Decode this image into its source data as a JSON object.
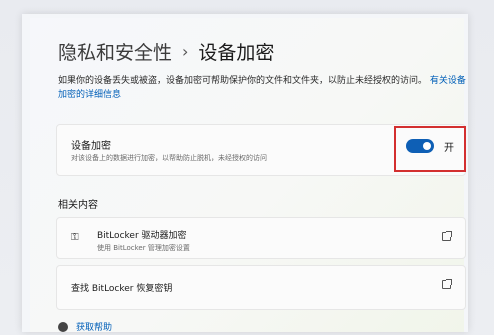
{
  "breadcrumb": {
    "parent": "隐私和安全性",
    "separator": "›",
    "current": "设备加密"
  },
  "description": {
    "text": "如果你的设备丢失或被盗，设备加密可帮助保护你的文件和文件夹，以防止未经授权的访问。",
    "link_line1": "有关设备",
    "link_line2": "加密的详细信息"
  },
  "encryption": {
    "title": "设备加密",
    "subtitle": "对该设备上的数据进行加密，以帮助防止脱机，未经授权的访问",
    "toggle_state_label": "开",
    "toggle_on": true,
    "accent_color": "#0e5fb5",
    "highlight_color": "#d32f2f"
  },
  "related": {
    "section_title": "相关内容",
    "items": [
      {
        "title": "BitLocker 驱动器加密",
        "subtitle": "使用 BitLocker 管理加密设置",
        "icon": "key-icon",
        "action_icon": "open-external-icon"
      },
      {
        "title": "查找 BitLocker 恢复密钥",
        "action_icon": "open-external-icon"
      }
    ]
  },
  "help": {
    "label": "获取帮助",
    "icon": "help-icon"
  }
}
